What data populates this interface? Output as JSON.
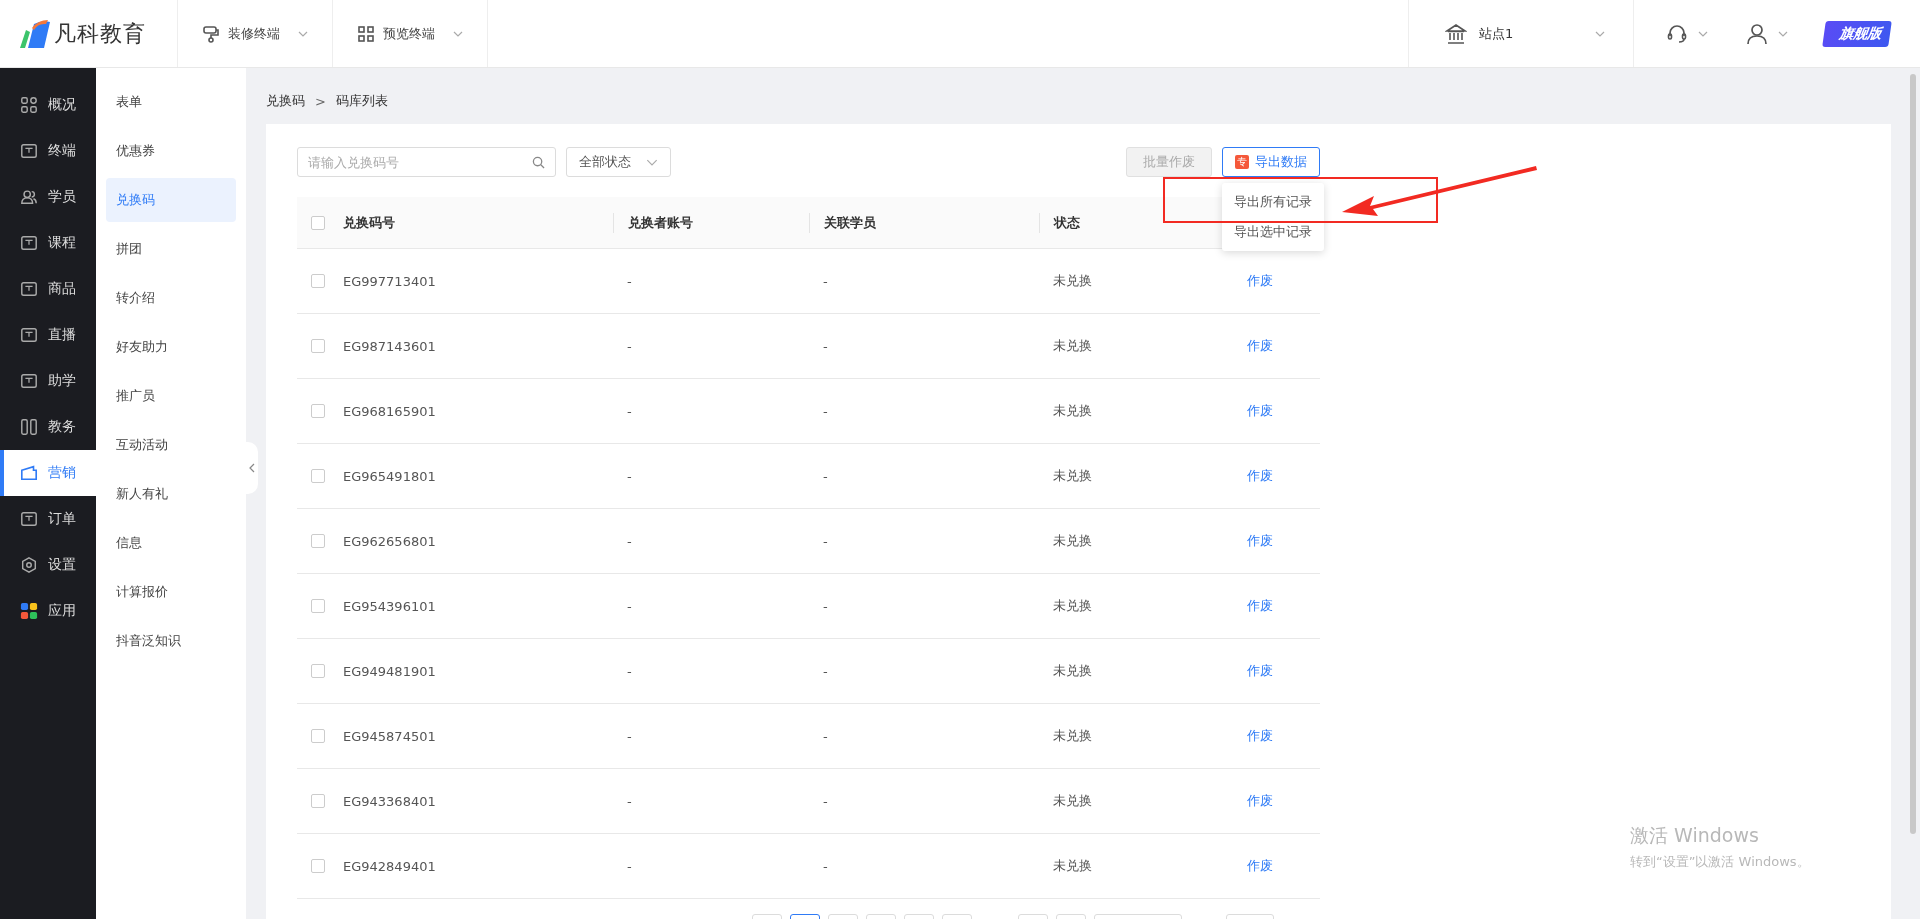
{
  "topbar": {
    "logo": "凡科教育",
    "menus": [
      {
        "label": "装修终端"
      },
      {
        "label": "预览终端"
      }
    ],
    "site": "站点1",
    "badge": "旗舰版"
  },
  "nav": [
    {
      "label": "概况",
      "selected": false
    },
    {
      "label": "终端",
      "selected": false
    },
    {
      "label": "学员",
      "selected": false
    },
    {
      "label": "课程",
      "selected": false
    },
    {
      "label": "商品",
      "selected": false
    },
    {
      "label": "直播",
      "selected": false
    },
    {
      "label": "助学",
      "selected": false
    },
    {
      "label": "教务",
      "selected": false
    },
    {
      "label": "营销",
      "selected": true
    },
    {
      "label": "订单",
      "selected": false
    },
    {
      "label": "设置",
      "selected": false
    },
    {
      "label": "应用",
      "selected": false
    }
  ],
  "subnav": [
    {
      "label": "表单",
      "selected": false
    },
    {
      "label": "优惠券",
      "selected": false
    },
    {
      "label": "兑换码",
      "selected": true
    },
    {
      "label": "拼团",
      "selected": false
    },
    {
      "label": "转介绍",
      "selected": false
    },
    {
      "label": "好友助力",
      "selected": false
    },
    {
      "label": "推广员",
      "selected": false
    },
    {
      "label": "互动活动",
      "selected": false
    },
    {
      "label": "新人有礼",
      "selected": false
    },
    {
      "label": "信息",
      "selected": false
    },
    {
      "label": "计算报价",
      "selected": false
    },
    {
      "label": "抖音泛知识",
      "selected": false
    }
  ],
  "breadcrumb": {
    "items": [
      "兑换码",
      "码库列表"
    ],
    "separator": ">"
  },
  "toolbar": {
    "search_placeholder": "请输入兑换码号",
    "status_filter": "全部状态",
    "batch_button": {
      "label": "批量作废",
      "disabled": true
    },
    "export_button": {
      "label": "导出数据",
      "badge": "专"
    }
  },
  "export_menu": [
    "导出所有记录",
    "导出选中记录"
  ],
  "table": {
    "columns": [
      "兑换码号",
      "兑换者账号",
      "关联学员",
      "状态"
    ],
    "header_checked": false,
    "rows": [
      {
        "code": "EG997713401",
        "account": "-",
        "student": "-",
        "status": "未兑换",
        "action": "作废",
        "checked": false
      },
      {
        "code": "EG987143601",
        "account": "-",
        "student": "-",
        "status": "未兑换",
        "action": "作废",
        "checked": false
      },
      {
        "code": "EG968165901",
        "account": "-",
        "student": "-",
        "status": "未兑换",
        "action": "作废",
        "checked": false
      },
      {
        "code": "EG965491801",
        "account": "-",
        "student": "-",
        "status": "未兑换",
        "action": "作废",
        "checked": false
      },
      {
        "code": "EG962656801",
        "account": "-",
        "student": "-",
        "status": "未兑换",
        "action": "作废",
        "checked": false
      },
      {
        "code": "EG954396101",
        "account": "-",
        "student": "-",
        "status": "未兑换",
        "action": "作废",
        "checked": false
      },
      {
        "code": "EG949481901",
        "account": "-",
        "student": "-",
        "status": "未兑换",
        "action": "作废",
        "checked": false
      },
      {
        "code": "EG945874501",
        "account": "-",
        "student": "-",
        "status": "未兑换",
        "action": "作废",
        "checked": false
      },
      {
        "code": "EG943368401",
        "account": "-",
        "student": "-",
        "status": "未兑换",
        "action": "作废",
        "checked": false
      },
      {
        "code": "EG942849401",
        "account": "-",
        "student": "-",
        "status": "未兑换",
        "action": "作废",
        "checked": false
      }
    ]
  },
  "pagination": {
    "pages": [
      {
        "selected": false
      },
      {
        "selected": true
      },
      {
        "selected": false
      },
      {
        "selected": false
      },
      {
        "selected": false
      },
      {
        "selected": false
      },
      {
        "selected": false
      },
      {
        "selected": false
      }
    ]
  },
  "watermark": {
    "title": "激活 Windows",
    "subtitle": "转到“设置”以激活 Windows。"
  }
}
